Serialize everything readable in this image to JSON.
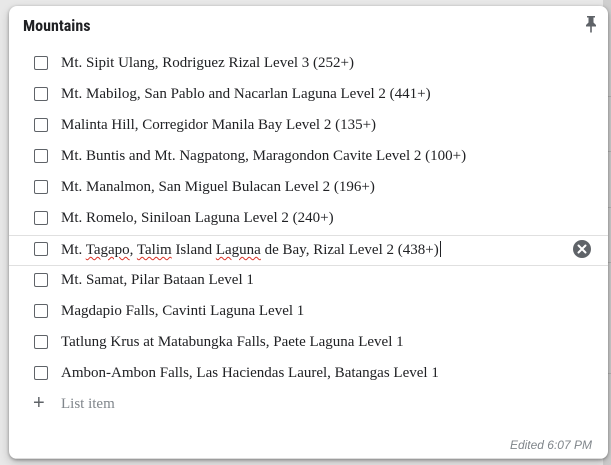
{
  "note": {
    "title": "Mountains",
    "items": [
      {
        "label": "Mt. Sipit Ulang, Rodriguez Rizal Level 3 (252+)",
        "checked": false
      },
      {
        "label": "Mt. Mabilog, San Pablo and Nacarlan Laguna Level 2 (441+)",
        "checked": false
      },
      {
        "label": "Malinta Hill, Corregidor Manila Bay Level 2 (135+)",
        "checked": false
      },
      {
        "label": "Mt. Buntis and Mt. Nagpatong, Maragondon Cavite Level 2 (100+)",
        "checked": false
      },
      {
        "label": "Mt. Manalmon, San Miguel Bulacan Level 2 (196+)",
        "checked": false
      },
      {
        "label": "Mt. Romelo, Siniloan Laguna Level 2 (240+)",
        "checked": false
      },
      {
        "label": "Mt. Tagapo, Talim Island Laguna de Bay, Rizal Level 2 (438+)",
        "checked": false,
        "active": true
      },
      {
        "label": "Mt. Samat, Pilar Bataan Level 1",
        "checked": false
      },
      {
        "label": "Magdapio Falls, Cavinti Laguna Level 1",
        "checked": false
      },
      {
        "label": "Tatlung Krus at Matabungka Falls, Paete Laguna Level 1",
        "checked": false
      },
      {
        "label": "Ambon-Ambon Falls, Las Haciendas Laurel, Batangas Level 1",
        "checked": false
      }
    ],
    "active_item_parts": {
      "p1": "Mt. ",
      "p2": "Tagapo",
      "p3": ", ",
      "p4": "Talim",
      "p5": " Island ",
      "p6": "Laguna",
      "p7": " de Bay, Rizal Level 2 (438+)"
    },
    "add_item_label": "List item",
    "add_icon": "plus-icon",
    "pin_icon": "pin-icon",
    "remove_icon": "close-circle-icon",
    "edited": "Edited 6:07 PM"
  },
  "colors": {
    "text": "#202124",
    "muted": "#80868b",
    "icon": "#5f6368",
    "spellcheck": "#d93025"
  }
}
